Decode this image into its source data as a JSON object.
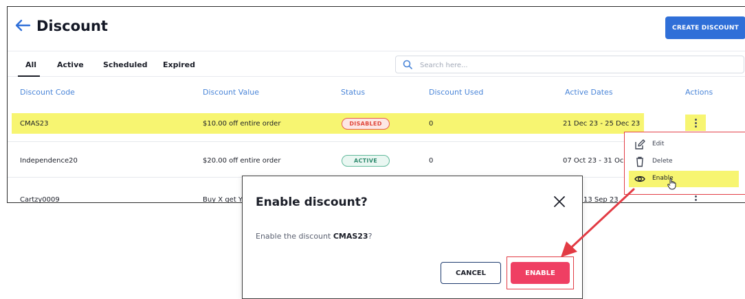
{
  "header": {
    "title": "Discount",
    "create_label": "CREATE DISCOUNT"
  },
  "tabs": [
    {
      "label": "All",
      "selected": true
    },
    {
      "label": "Active"
    },
    {
      "label": "Scheduled"
    },
    {
      "label": "Expired"
    }
  ],
  "search": {
    "placeholder": "Search here..."
  },
  "table": {
    "columns": [
      "Discount Code",
      "Discount Value",
      "Status",
      "Discount Used",
      "Active Dates",
      "Actions"
    ],
    "rows": [
      {
        "code": "CMAS23",
        "value": "$10.00 off entire order",
        "status": "DISABLED",
        "used": "0",
        "dates": "21 Dec 23 - 25 Dec 23"
      },
      {
        "code": "Independence20",
        "value": "$20.00 off entire order",
        "status": "ACTIVE",
        "used": "0",
        "dates": "07 Oct 23 - 31 Oc"
      },
      {
        "code": "Cartzy0009",
        "value": "Buy X get Y",
        "status": "",
        "used": "",
        "dates": "13 Sep 23"
      }
    ]
  },
  "menu": {
    "items": [
      {
        "label": "Edit",
        "icon": "edit-icon"
      },
      {
        "label": "Delete",
        "icon": "trash-icon"
      },
      {
        "label": "Enable",
        "icon": "eye-icon"
      }
    ]
  },
  "dialog": {
    "title": "Enable discount?",
    "body_prefix": "Enable the discount ",
    "body_code": "CMAS23",
    "body_suffix": "?",
    "cancel_label": "CANCEL",
    "enable_label": "ENABLE"
  },
  "colors": {
    "accent": "#2f6fd8",
    "link": "#4a85d8",
    "highlight": "#f7f571",
    "danger": "#ef3f63",
    "annotation": "#e23b44"
  }
}
